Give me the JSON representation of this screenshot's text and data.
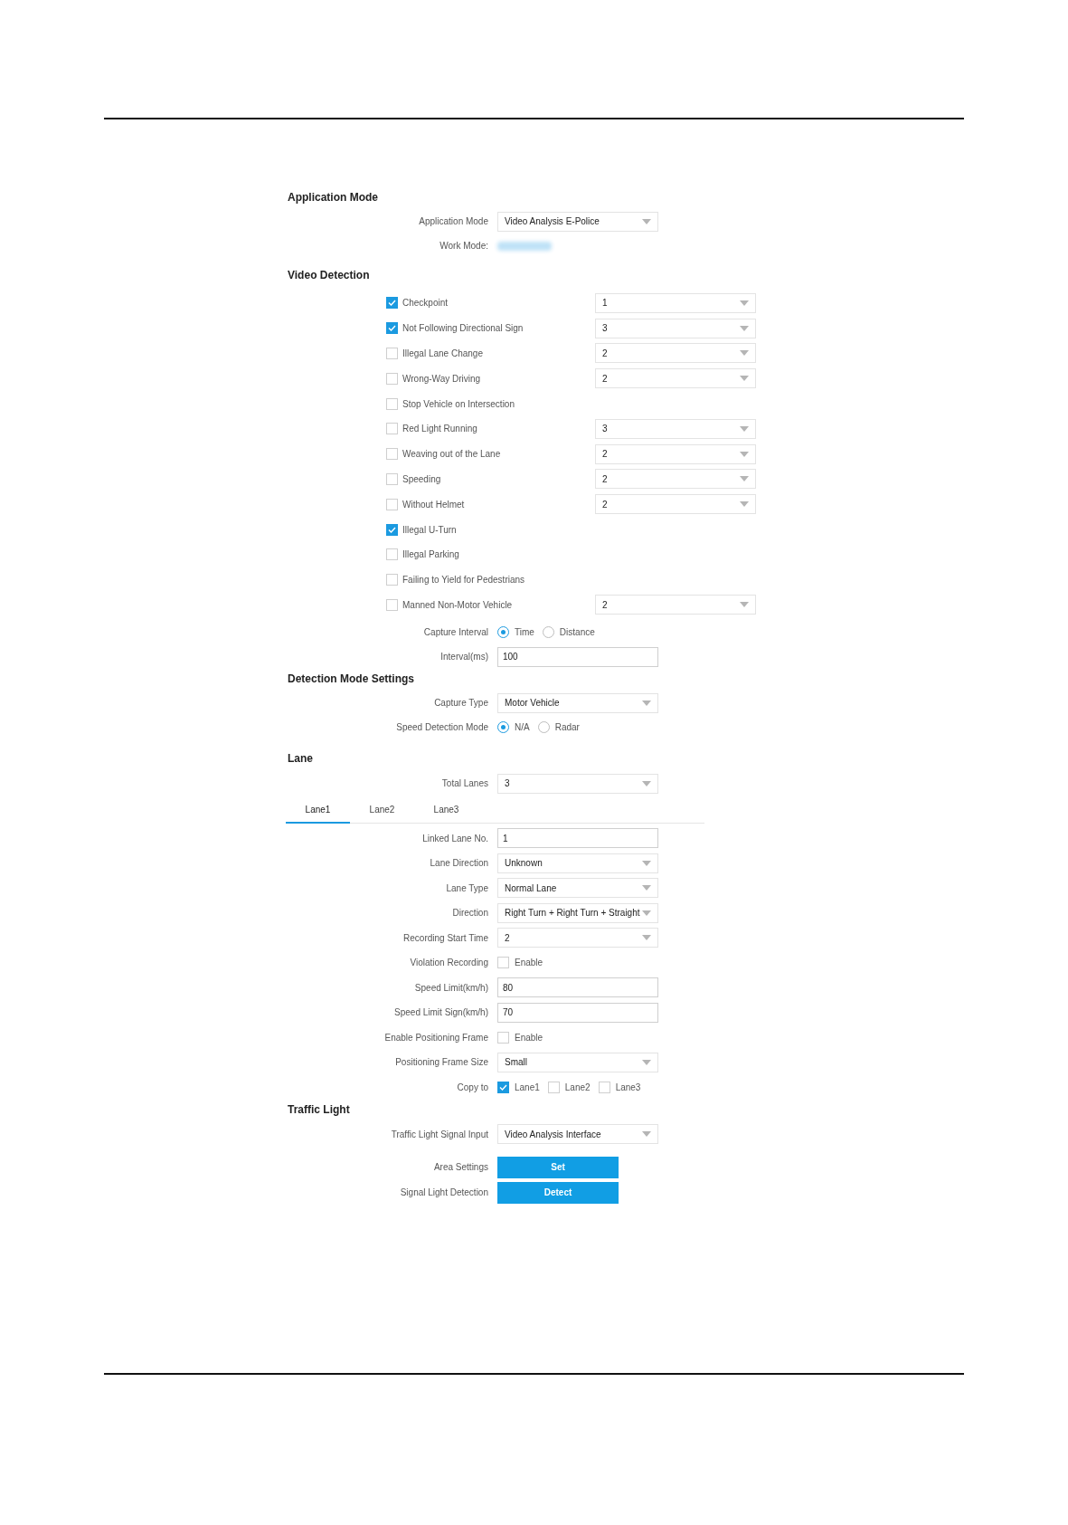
{
  "sections": [
    {
      "heading": "Application Mode",
      "fields": [
        {
          "kind": "select",
          "label": "Application Mode",
          "value": "Video Analysis E-Police"
        },
        {
          "kind": "redacted",
          "label": "Work Mode:"
        }
      ]
    },
    {
      "heading": "Video Detection",
      "rules": [
        {
          "label": "Checkpoint",
          "checked": true,
          "select": "1"
        },
        {
          "label": "Not Following Directional Sign",
          "checked": true,
          "select": "3"
        },
        {
          "label": "Illegal Lane Change",
          "checked": false,
          "select": "2"
        },
        {
          "label": "Wrong-Way Driving",
          "checked": false,
          "select": "2"
        },
        {
          "label": "Stop Vehicle on Intersection",
          "checked": false
        },
        {
          "label": "Red Light Running",
          "checked": false,
          "select": "3"
        },
        {
          "label": "Weaving out of the Lane",
          "checked": false,
          "select": "2"
        },
        {
          "label": "Speeding",
          "checked": false,
          "select": "2"
        },
        {
          "label": "Without Helmet",
          "checked": false,
          "select": "2"
        },
        {
          "label": "Illegal U-Turn",
          "checked": true
        },
        {
          "label": "Illegal Parking",
          "checked": false
        },
        {
          "label": "Failing to Yield for Pedestrians",
          "checked": false
        },
        {
          "label": "Manned Non-Motor Vehicle",
          "checked": false,
          "select": "2"
        }
      ],
      "fields": [
        {
          "kind": "radio",
          "label": "Capture Interval",
          "options": [
            {
              "label": "Time",
              "selected": true
            },
            {
              "label": "Distance",
              "selected": false
            }
          ]
        },
        {
          "kind": "input",
          "label": "Interval(ms)",
          "value": "100"
        }
      ]
    },
    {
      "heading": "Detection Mode Settings",
      "fields": [
        {
          "kind": "select",
          "label": "Capture Type",
          "value": "Motor Vehicle"
        },
        {
          "kind": "radio",
          "label": "Speed Detection Mode",
          "options": [
            {
              "label": "N/A",
              "selected": true
            },
            {
              "label": "Radar",
              "selected": false
            }
          ]
        }
      ]
    },
    {
      "heading": "Lane",
      "fields": [
        {
          "kind": "select",
          "label": "Total Lanes",
          "value": "3"
        }
      ],
      "tabs": [
        {
          "label": "Lane1",
          "selected": true
        },
        {
          "label": "Lane2",
          "selected": false
        },
        {
          "label": "Lane3",
          "selected": false
        }
      ],
      "tab_fields": [
        {
          "kind": "input",
          "label": "Linked Lane No.",
          "value": "1"
        },
        {
          "kind": "select",
          "label": "Lane Direction",
          "value": "Unknown"
        },
        {
          "kind": "select",
          "label": "Lane Type",
          "value": "Normal Lane"
        },
        {
          "kind": "select",
          "label": "Direction",
          "value": "Right Turn + Right Turn + Straight"
        },
        {
          "kind": "select",
          "label": "Recording Start Time",
          "value": "2"
        },
        {
          "kind": "checkbox",
          "label": "Violation Recording",
          "options": [
            {
              "label": "Enable",
              "checked": false
            }
          ]
        },
        {
          "kind": "input",
          "label": "Speed Limit(km/h)",
          "value": "80"
        },
        {
          "kind": "input",
          "label": "Speed Limit Sign(km/h)",
          "value": "70"
        },
        {
          "kind": "checkbox",
          "label": "Enable Positioning Frame",
          "options": [
            {
              "label": "Enable",
              "checked": false
            }
          ]
        },
        {
          "kind": "select",
          "label": "Positioning Frame Size",
          "value": "Small"
        },
        {
          "kind": "checkbox",
          "label": "Copy to",
          "options": [
            {
              "label": "Lane1",
              "checked": true
            },
            {
              "label": "Lane2",
              "checked": false
            },
            {
              "label": "Lane3",
              "checked": false
            }
          ]
        }
      ]
    },
    {
      "heading": "Traffic Light",
      "fields": [
        {
          "kind": "select",
          "label": "Traffic Light Signal Input",
          "value": "Video Analysis Interface"
        },
        {
          "kind": "button",
          "label": "Area Settings",
          "value": "Set"
        },
        {
          "kind": "button",
          "label": "Signal Light Detection",
          "value": "Detect"
        }
      ]
    }
  ]
}
